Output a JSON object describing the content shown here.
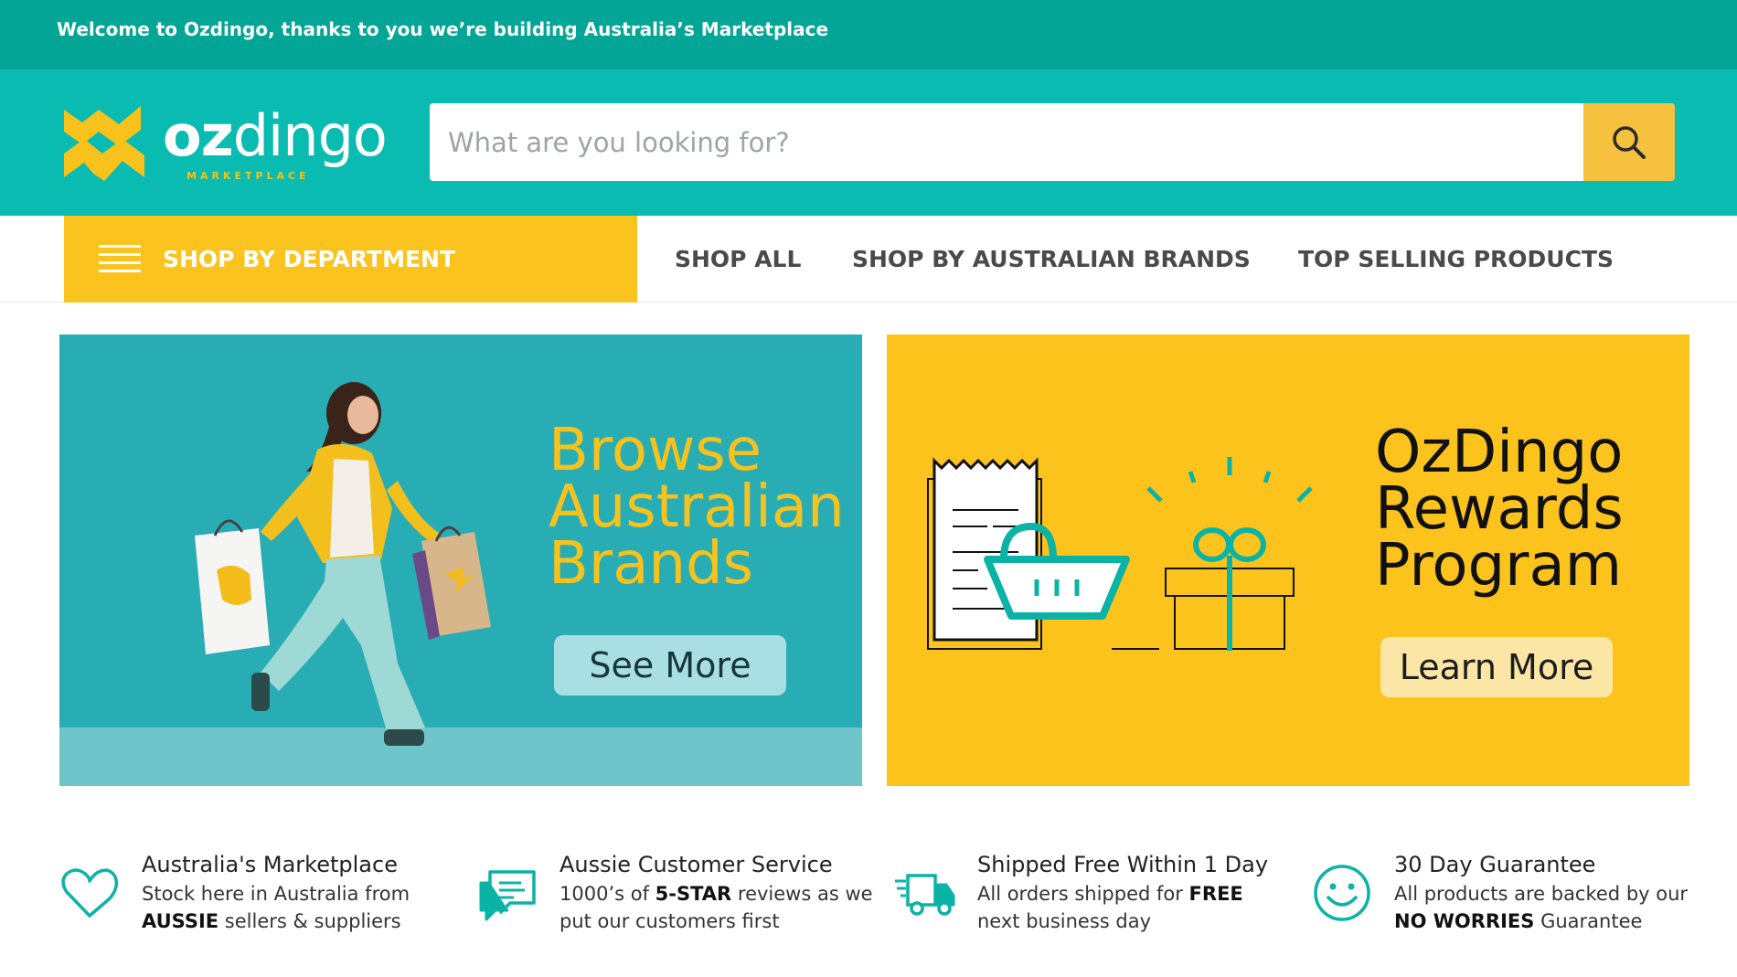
{
  "topbar": {
    "message": "Welcome to Ozdingo, thanks to you we’re building Australia’s Marketplace"
  },
  "header": {
    "logo_bold": "oz",
    "logo_light": "dingo",
    "logo_tagline": "MARKETPLACE",
    "search_placeholder": "What are you looking for?",
    "search_icon": "search-icon"
  },
  "nav": {
    "department_label": "SHOP BY DEPARTMENT",
    "links": [
      "SHOP ALL",
      "SHOP BY AUSTRALIAN BRANDS",
      "TOP SELLING PRODUCTS"
    ]
  },
  "banners": {
    "left": {
      "title_lines": [
        "Browse",
        "Australian",
        "Brands"
      ],
      "button": "See More"
    },
    "right": {
      "title_lines": [
        "OzDingo",
        "Rewards",
        "Program"
      ],
      "button": "Learn More"
    }
  },
  "features": [
    {
      "icon": "heart-icon",
      "title": "Australia's Marketplace",
      "line1_pre": "Stock here in Australia from",
      "line2_bold": "AUSSIE",
      "line2_post": " sellers & suppliers"
    },
    {
      "icon": "chat-icon",
      "title": "Aussie Customer Service",
      "line1_pre": "1000’s of ",
      "line1_bold": "5-STAR",
      "line1_post": " reviews as we",
      "line2_pre": "put our customers first"
    },
    {
      "icon": "truck-icon",
      "title": "Shipped Free Within 1 Day",
      "line1_pre": "All orders shipped for ",
      "line1_bold": "FREE",
      "line2_pre": "next business day"
    },
    {
      "icon": "smiley-icon",
      "title": "30 Day Guarantee",
      "line1_pre": "All products are backed by our",
      "line2_bold": "NO WORRIES",
      "line2_post": " Guarantee"
    }
  ],
  "colors": {
    "topbar": "#03a597",
    "header": "#09bbb0",
    "accent_yellow": "#fbc31e",
    "banner_teal": "#29adb5",
    "search_button": "#f5c13e",
    "icon_teal": "#0bb3a6"
  }
}
